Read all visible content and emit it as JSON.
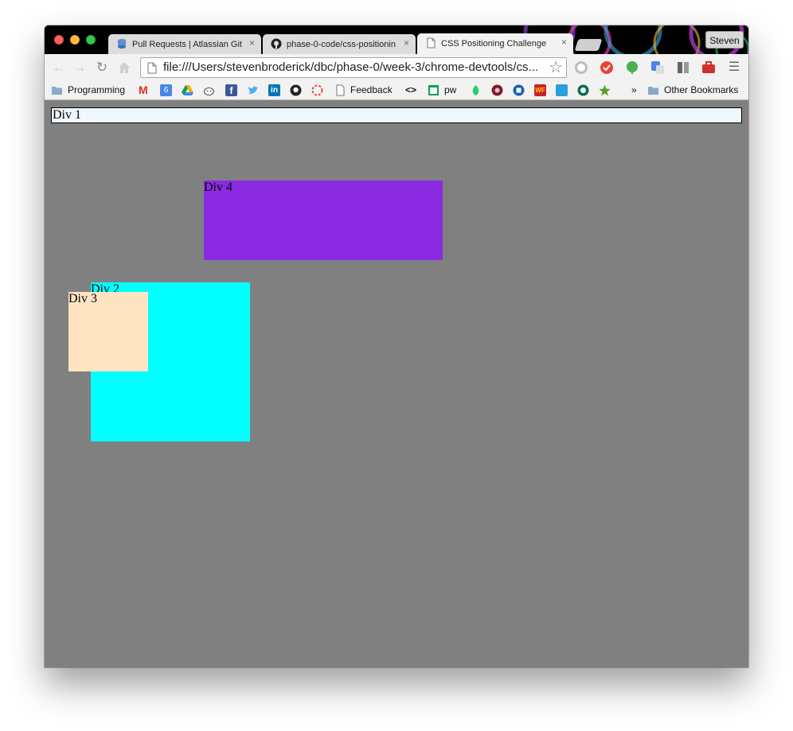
{
  "browser": {
    "tabs": [
      {
        "title": "Pull Requests | Atlassian Git",
        "icon": "database-icon"
      },
      {
        "title": "phase-0-code/css-positionin",
        "icon": "github-icon"
      },
      {
        "title": "CSS Positioning Challenge",
        "icon": "page-icon"
      }
    ],
    "close_glyph": "×",
    "profile_name": "Steven",
    "url": "file:///Users/stevenbroderick/dbc/phase-0/week-3/chrome-devtools/cs...",
    "bookmarks": {
      "programming": "Programming",
      "feedback": "Feedback",
      "code_symbol": "<>",
      "pw": "pw",
      "overflow": "»",
      "other": "Other Bookmarks"
    }
  },
  "page": {
    "div1": "Div 1",
    "div2": "Div 2",
    "div3": "Div 3",
    "div4": "Div 4"
  },
  "colors": {
    "page_bg": "#808080",
    "div1_bg": "#f0f8ff",
    "div2_bg": "#00ffff",
    "div3_bg": "#ffe4c4",
    "div4_bg": "#8a2be2"
  }
}
